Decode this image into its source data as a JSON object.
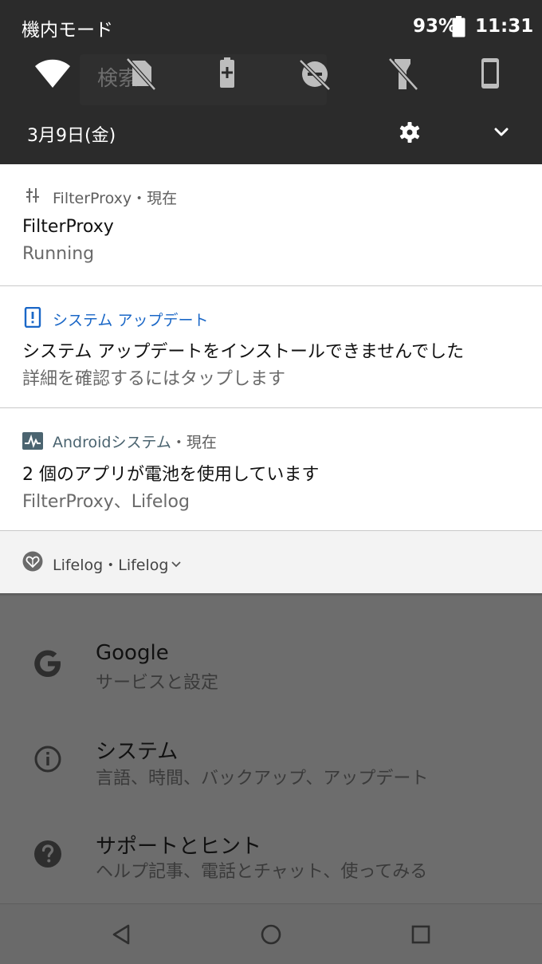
{
  "status_bar": {
    "mode": "機内モード",
    "battery": "93%",
    "time": "11:31"
  },
  "quick_settings": {
    "search_placeholder": "検索",
    "tiles": [
      "wifi-icon",
      "sim-off-icon",
      "battery-saver-icon",
      "do-not-disturb-off-icon",
      "flashlight-off-icon",
      "phone-rotation-icon"
    ]
  },
  "shade_footer": {
    "date": "3月9日(金)"
  },
  "notifications": [
    {
      "app": "FilterProxy",
      "time": "現在",
      "separator": "・",
      "title": "FilterProxy",
      "text": "Running",
      "icon": "filter-proxy-icon"
    },
    {
      "app": "システム アップデート",
      "title": "システム アップデートをインストールできませんでした",
      "text": "詳細を確認するにはタップします",
      "icon": "system-update-alert-icon",
      "accent": "#1a67c7"
    },
    {
      "app": "Androidシステム",
      "time": "現在",
      "separator": "・",
      "title": "2 個のアプリが電池を使用しています",
      "text": "FilterProxy、Lifelog",
      "icon": "android-system-activity-icon"
    },
    {
      "app": "Lifelog",
      "channel": "Lifelog",
      "separator": "・",
      "icon": "lifelog-heart-icon"
    }
  ],
  "settings_items": [
    {
      "title": "Google",
      "subtitle": "サービスと設定",
      "icon": "google-g-icon"
    },
    {
      "title": "システム",
      "subtitle": "言語、時間、バックアップ、アップデート",
      "icon": "info-icon"
    },
    {
      "title": "サポートとヒント",
      "subtitle": "ヘルプ記事、電話とチャット、使ってみる",
      "icon": "help-icon"
    }
  ],
  "colors": {
    "shade_bg": "#2b2b2b",
    "scrim_bg": "#6d6d6d",
    "update_accent": "#1a67c7"
  }
}
